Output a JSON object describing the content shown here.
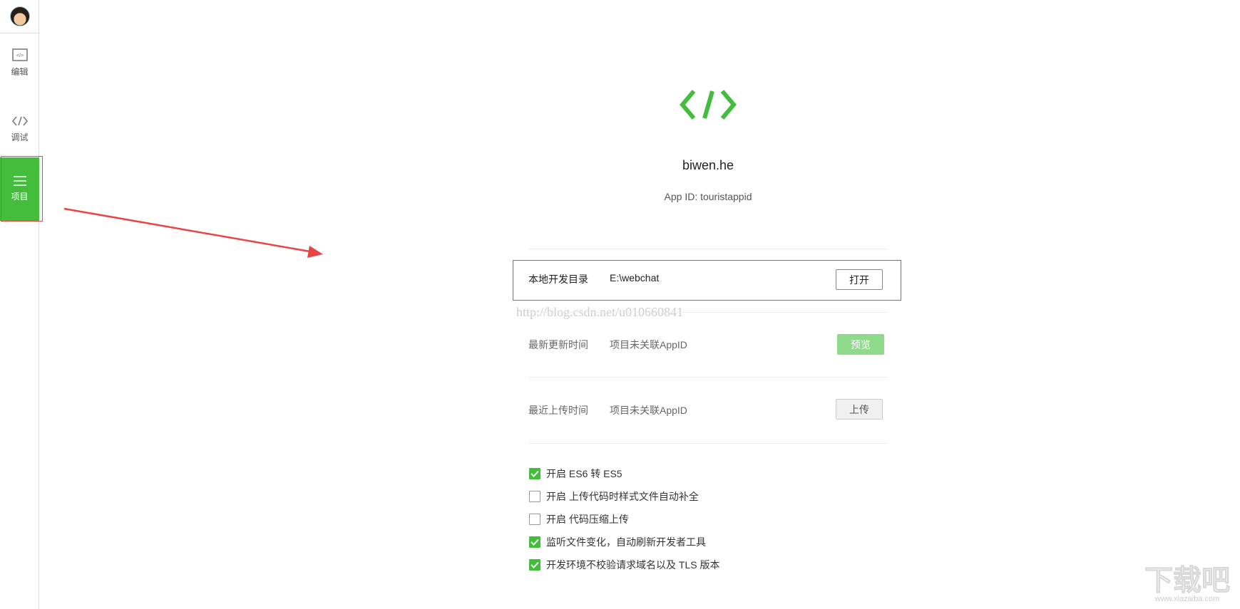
{
  "sidebar": {
    "items": [
      {
        "label": "编辑",
        "icon": "code-window-icon"
      },
      {
        "label": "调试",
        "icon": "code-icon"
      },
      {
        "label": "项目",
        "icon": "menu-icon",
        "active": true
      }
    ]
  },
  "project": {
    "name": "biwen.he",
    "app_id": "App ID: touristappid"
  },
  "rows": [
    {
      "label": "本地开发目录",
      "value": "E:\\webchat",
      "button": "打开"
    },
    {
      "label": "最新更新时间",
      "value": "项目未关联AppID",
      "button": "预览"
    },
    {
      "label": "最近上传时间",
      "value": "项目未关联AppID",
      "button": "上传"
    }
  ],
  "options": [
    {
      "label": "开启 ES6 转 ES5",
      "checked": true
    },
    {
      "label": "开启 上传代码时样式文件自动补全",
      "checked": false
    },
    {
      "label": "开启 代码压缩上传",
      "checked": false
    },
    {
      "label": "监听文件变化，自动刷新开发者工具",
      "checked": true
    },
    {
      "label": "开发环境不校验请求域名以及 TLS 版本",
      "checked": true
    }
  ],
  "watermarks": {
    "csdn": "http://blog.csdn.net/u010660841",
    "site": "下载吧",
    "site_url": "www.xiazaiba.com"
  },
  "colors": {
    "accent": "#44bd3d",
    "annotation": "#e84444"
  }
}
